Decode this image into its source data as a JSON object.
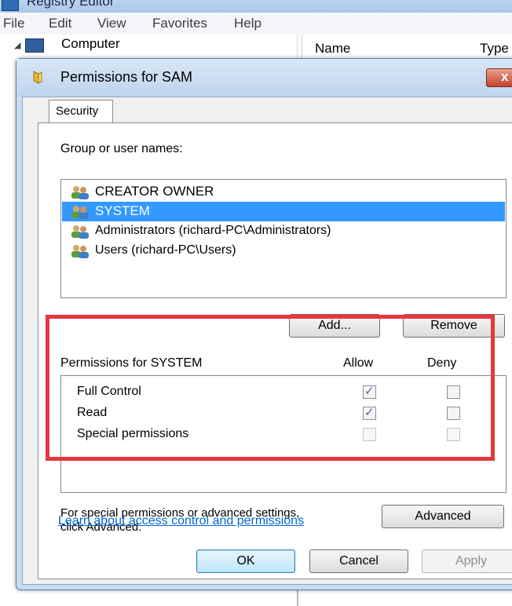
{
  "background": {
    "window_title": "Registry Editor",
    "menu": [
      "File",
      "Edit",
      "View",
      "Favorites",
      "Help"
    ],
    "tree_root": "Computer",
    "columns": [
      "Name",
      "Type"
    ]
  },
  "dialog": {
    "title": "Permissions for SAM",
    "close_glyph": "x",
    "tab_label": "Security",
    "group_label": "Group or user names:",
    "users": [
      {
        "name": "CREATOR OWNER",
        "selected": false
      },
      {
        "name": "SYSTEM",
        "selected": true
      },
      {
        "name": "Administrators (richard-PC\\Administrators)",
        "selected": false
      },
      {
        "name": "Users (richard-PC\\Users)",
        "selected": false
      }
    ],
    "add_button": "Add...",
    "remove_button": "Remove",
    "permissions_header": "Permissions for SYSTEM",
    "allow_header": "Allow",
    "deny_header": "Deny",
    "permissions": [
      {
        "name": "Full Control",
        "allow": "checked",
        "deny": "unchecked"
      },
      {
        "name": "Read",
        "allow": "checked",
        "deny": "unchecked"
      },
      {
        "name": "Special permissions",
        "allow": "disabled",
        "deny": "disabled"
      }
    ],
    "advanced_text_line1": "For special permissions or advanced settings,",
    "advanced_text_line2": "click Advanced.",
    "advanced_button": "Advanced",
    "learn_link": "Learn about access control and permissions",
    "ok_button": "OK",
    "cancel_button": "Cancel",
    "apply_button": "Apply"
  },
  "colors": {
    "selection": "#3399ff",
    "highlight_border": "#e8363c",
    "link": "#0066cc"
  }
}
